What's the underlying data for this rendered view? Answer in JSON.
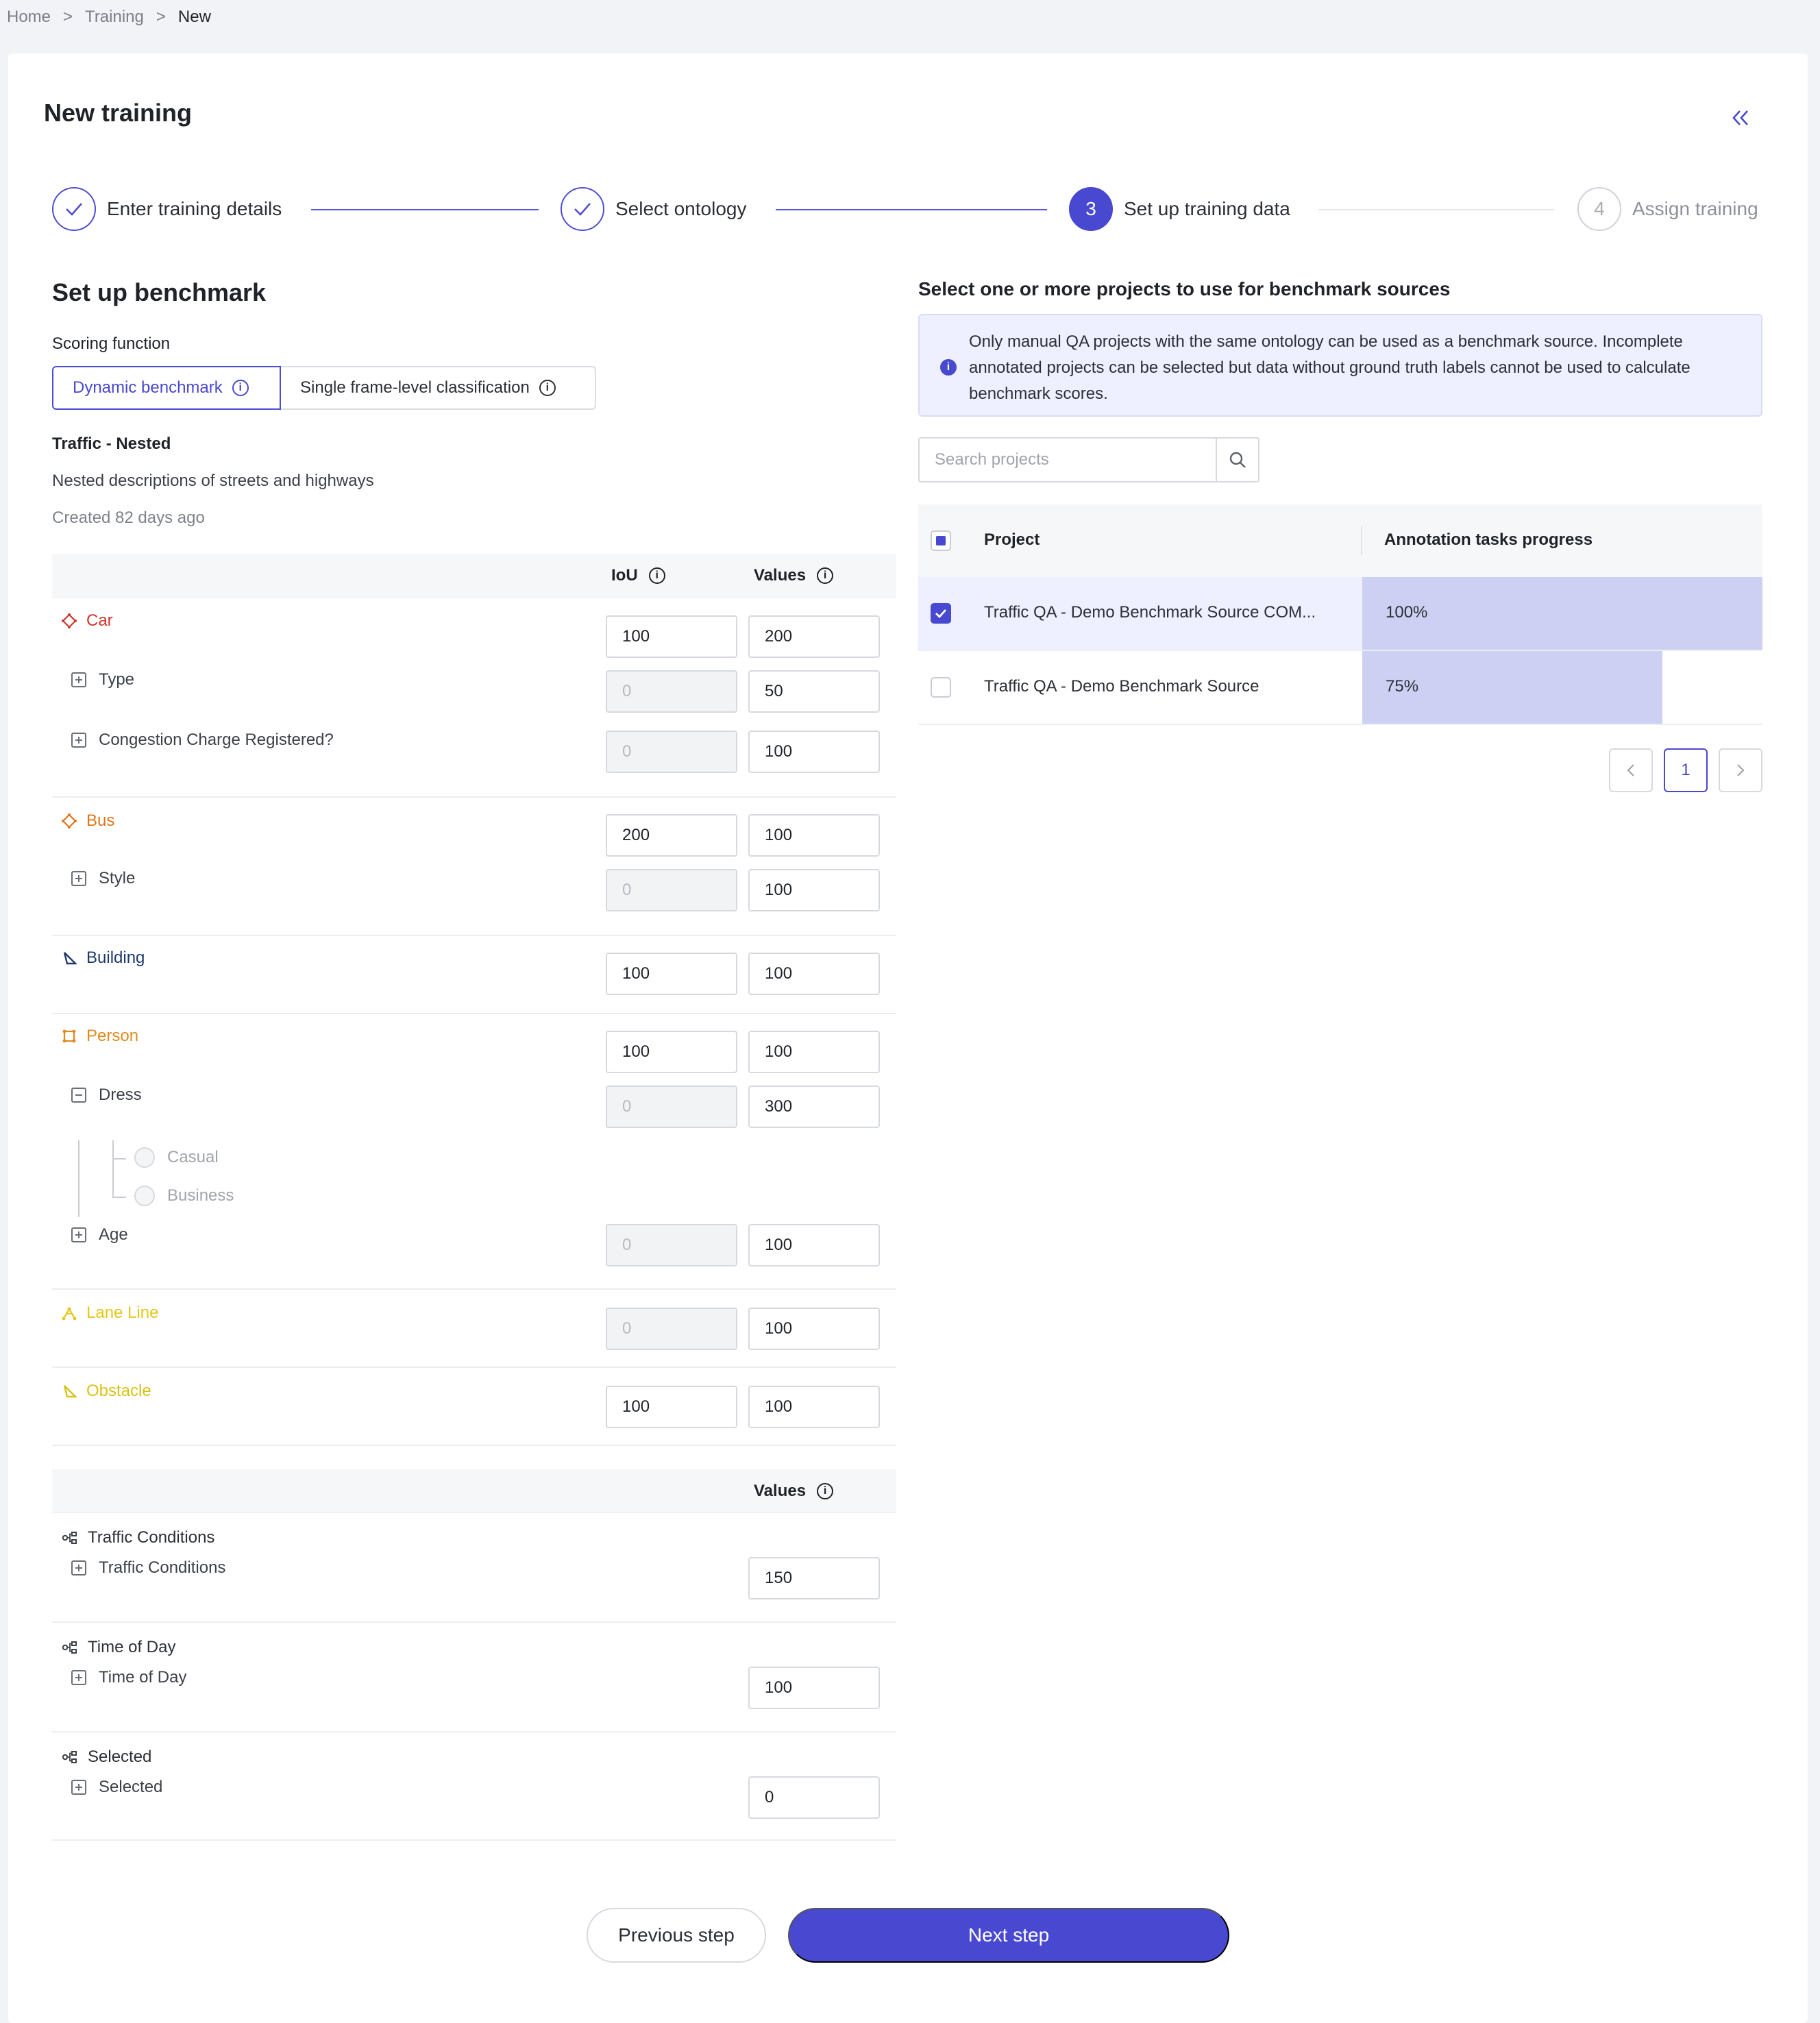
{
  "breadcrumb": {
    "home": "Home",
    "sep": ">",
    "training": "Training",
    "current": "New"
  },
  "page_title": "New training",
  "stepper": {
    "steps": [
      {
        "label": "Enter training details",
        "state": "done"
      },
      {
        "label": "Select ontology",
        "state": "done"
      },
      {
        "label": "Set up training data",
        "number": "3",
        "state": "active"
      },
      {
        "label": "Assign training",
        "number": "4",
        "state": "pending"
      }
    ]
  },
  "benchmark": {
    "title": "Set up benchmark",
    "scoring_label": "Scoring function",
    "scoring_options": [
      "Dynamic benchmark",
      "Single frame-level classification"
    ],
    "ontology_name": "Traffic - Nested",
    "ontology_desc": "Nested descriptions of streets and highways",
    "created": "Created 82 days ago",
    "col_iou": "IoU",
    "col_values": "Values",
    "objects": [
      {
        "name": "Car",
        "color": "#d0342c",
        "icon": "polygon-icon",
        "iou": "100",
        "value": "200",
        "attributes": [
          {
            "name": "Type",
            "iou": "0",
            "value": "50"
          },
          {
            "name": "Congestion Charge Registered?",
            "iou": "0",
            "value": "100"
          }
        ]
      },
      {
        "name": "Bus",
        "color": "#e0751a",
        "icon": "polygon-icon",
        "iou": "200",
        "value": "100",
        "attributes": [
          {
            "name": "Style",
            "iou": "0",
            "value": "100"
          }
        ]
      },
      {
        "name": "Building",
        "color": "#1d3a6b",
        "icon": "polyline-icon",
        "iou": "100",
        "value": "100",
        "attributes": []
      },
      {
        "name": "Person",
        "color": "#e08a1a",
        "icon": "bounding-box-icon",
        "iou": "100",
        "value": "100",
        "attributes": [
          {
            "name": "Dress",
            "iou": "0",
            "value": "300",
            "options": [
              "Casual",
              "Business"
            ]
          },
          {
            "name": "Age",
            "iou": "0",
            "value": "100"
          }
        ]
      },
      {
        "name": "Lane Line",
        "color": "#e6c619",
        "icon": "skeleton-icon",
        "iou": "0",
        "value": "100",
        "attributes": []
      },
      {
        "name": "Obstacle",
        "color": "#d9c116",
        "icon": "polyline-icon",
        "iou": "100",
        "value": "100",
        "attributes": []
      }
    ],
    "classifications": [
      {
        "name": "Traffic Conditions",
        "sub": "Traffic Conditions",
        "value": "150"
      },
      {
        "name": "Time of Day",
        "sub": "Time of Day",
        "value": "100"
      },
      {
        "name": "Selected",
        "sub": "Selected",
        "value": "0"
      }
    ]
  },
  "sources": {
    "title": "Select one or more projects to use for benchmark sources",
    "info": "Only manual QA projects with the same ontology can be used as a benchmark source. Incomplete annotated projects can be selected but data without ground truth labels cannot be used to calculate benchmark scores.",
    "search_placeholder": "Search projects",
    "col_project": "Project",
    "col_progress": "Annotation tasks progress",
    "projects": [
      {
        "name": "Traffic QA - Demo Benchmark Source COM...",
        "progress": 1.0,
        "progress_label": "100%",
        "checked": true
      },
      {
        "name": "Traffic QA - Demo Benchmark Source",
        "progress": 0.75,
        "progress_label": "75%",
        "checked": false
      }
    ],
    "page": "1"
  },
  "footer": {
    "prev": "Previous step",
    "next": "Next step"
  },
  "colors": {
    "accent": "#4848d0"
  }
}
